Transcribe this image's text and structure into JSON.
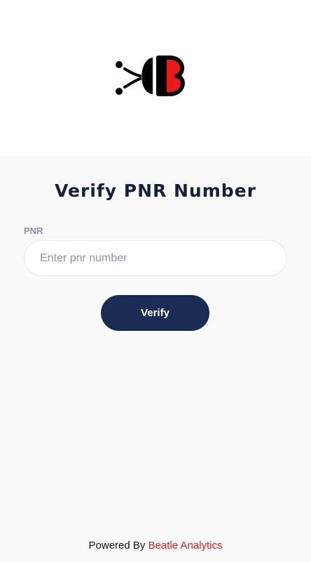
{
  "header": {
    "logo_icon": "beatle-logo-icon"
  },
  "page": {
    "title": "Verify PNR Number"
  },
  "form": {
    "pnr_label": "PNR",
    "pnr_value": "",
    "pnr_placeholder": "Enter pnr number",
    "verify_label": "Verify"
  },
  "footer": {
    "prefix": "Powered By",
    "brand": "Beatle Analytics"
  },
  "colors": {
    "primary": "#1a2e55",
    "brand_red": "#e81a1a",
    "title": "#14213d",
    "label": "#8c93a8"
  }
}
